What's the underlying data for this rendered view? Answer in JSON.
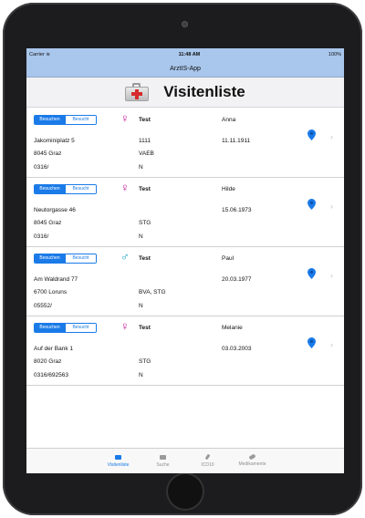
{
  "statusbar": {
    "carrier": "Carrier ≋",
    "time": "11:48 AM",
    "battery": "100%"
  },
  "navbar": {
    "title": "ArztIS-App"
  },
  "header": {
    "title": "Visitenliste"
  },
  "segment": {
    "visit": "Besuchen",
    "visited": "Besucht"
  },
  "patients": [
    {
      "gender": "female",
      "symbol": "♀",
      "test": "Test",
      "name": "Anna",
      "street": "Jakominiplatz 5",
      "code": "1111",
      "dob": "11.11.1911",
      "city": "8045 Graz",
      "insurance": "VAEB",
      "phone": "0316/",
      "flag": "N"
    },
    {
      "gender": "female",
      "symbol": "♀",
      "test": "Test",
      "name": "Hilde",
      "street": "Neutorgasse 46",
      "code": "",
      "dob": "15.06.1973",
      "city": "8045 Graz",
      "insurance": "STG",
      "phone": "0316/",
      "flag": "N"
    },
    {
      "gender": "male",
      "symbol": "♂",
      "test": "Test",
      "name": "Paul",
      "street": "Am Waldrand 77",
      "code": "",
      "dob": "20.03.1977",
      "city": "6700 Loruns",
      "insurance": "BVA, STG",
      "phone": "05552/",
      "flag": "N"
    },
    {
      "gender": "female",
      "symbol": "♀",
      "test": "Test",
      "name": "Melanie",
      "street": "Auf der Bank 1",
      "code": "",
      "dob": "03.03.2003",
      "city": "8020 Graz",
      "insurance": "STG",
      "phone": "0316/692563",
      "flag": "N"
    }
  ],
  "tabs": [
    {
      "label": "Visitenliste",
      "active": true
    },
    {
      "label": "Suche"
    },
    {
      "label": "ICD10"
    },
    {
      "label": "Medikamente"
    }
  ],
  "colors": {
    "accent": "#1a7ae8",
    "navbar": "#a9c6ec",
    "female": "#c01a92",
    "male": "#1a9ec0"
  }
}
